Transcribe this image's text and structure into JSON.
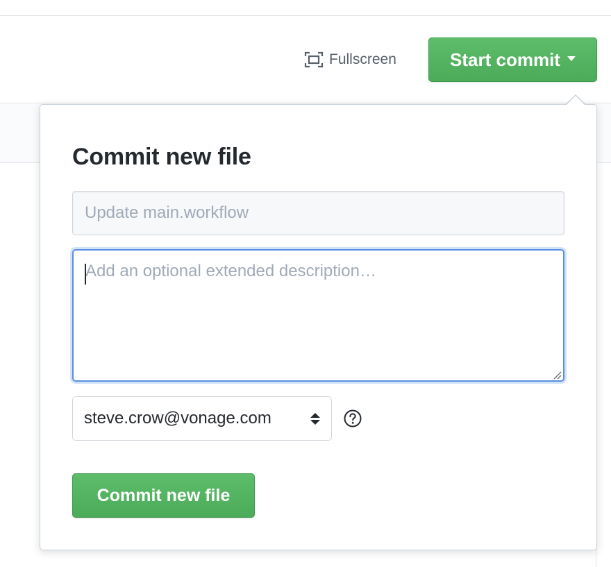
{
  "toolbar": {
    "fullscreen_label": "Fullscreen",
    "fullscreen_icon": "fullscreen-icon",
    "start_commit_label": "Start commit",
    "start_commit_icon": "caret-down-icon"
  },
  "commit_form": {
    "title": "Commit new file",
    "summary_placeholder": "Update main.workflow",
    "summary_value": "",
    "description_placeholder": "Add an optional extended description…",
    "description_value": "",
    "email_selected": "steve.crow@vonage.com",
    "email_icon": "select-arrows-icon",
    "help_icon": "question-circle-icon",
    "submit_label": "Commit new file"
  },
  "colors": {
    "primary_button": "#4fb35d",
    "focus_border": "#5a8fe0",
    "placeholder_text": "#a0aab6",
    "muted_text": "#586069"
  }
}
